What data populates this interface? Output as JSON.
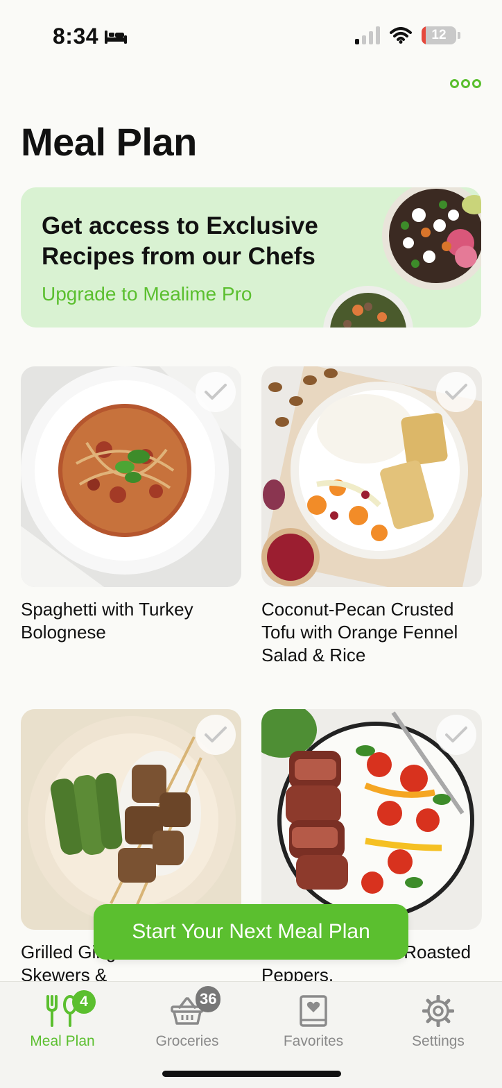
{
  "status_bar": {
    "time": "8:34",
    "battery": "12"
  },
  "header": {
    "title": "Meal Plan",
    "more_icon": "more-circles-icon"
  },
  "promo": {
    "title": "Get access to Exclusive Recipes from our Chefs",
    "link": "Upgrade to Mealime Pro"
  },
  "recipes": [
    {
      "title": "Spaghetti with Turkey Bolognese"
    },
    {
      "title": "Coconut-Pecan Crusted Tofu with Orange Fennel Salad & Rice"
    },
    {
      "title": "Grilled Ginger-Garlic Steak Skewers &"
    },
    {
      "title": "Sliced Steak with Roasted Peppers."
    }
  ],
  "start_button": {
    "label": "Start Your Next Meal Plan"
  },
  "tabs": [
    {
      "label": "Meal Plan",
      "badge": "4",
      "icon": "fork-spoon-icon"
    },
    {
      "label": "Groceries",
      "badge": "36",
      "icon": "basket-icon"
    },
    {
      "label": "Favorites",
      "icon": "heart-book-icon"
    },
    {
      "label": "Settings",
      "icon": "gear-icon"
    }
  ],
  "colors": {
    "accent": "#5bbf2f",
    "banner": "#d9f2d2",
    "background": "#fafaf7"
  }
}
